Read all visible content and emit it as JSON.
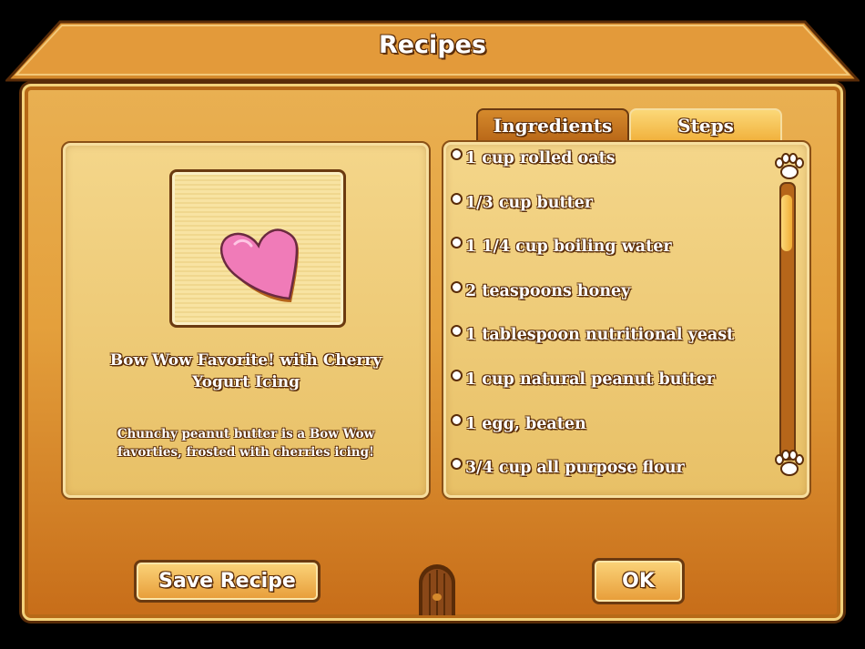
{
  "window": {
    "title": "Recipes"
  },
  "tabs": [
    {
      "label": "Ingredients",
      "selected": false
    },
    {
      "label": "Steps",
      "selected": true
    }
  ],
  "recipe": {
    "name": "Bow Wow Favorite! with Cherry Yogurt Icing",
    "description": "Chunchy peanut butter is a Bow Wow favorties, frosted with cherries icing!",
    "image_icon": "pink-heart-cookie-icon"
  },
  "ingredients": [
    "1 cup rolled oats",
    "1/3 cup butter",
    "1 1/4 cup boiling water",
    "2 teaspoons honey",
    "1 tablespoon nutritional yeast",
    "1 cup natural peanut butter",
    "1 egg, beaten",
    "3/4 cup all purpose flour"
  ],
  "scrollbar": {
    "position": 0.0
  },
  "buttons": {
    "save_recipe": "Save Recipe",
    "ok": "OK"
  },
  "colors": {
    "wood": "#e4a03c",
    "panel": "#f0cc76",
    "outline": "#5a2c08",
    "heart": "#f07bb8"
  }
}
